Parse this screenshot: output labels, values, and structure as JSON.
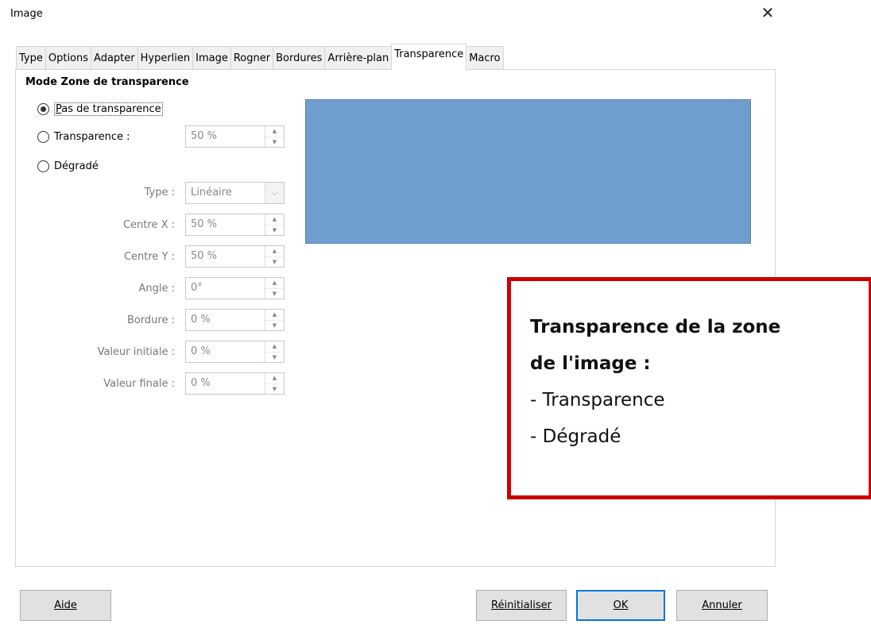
{
  "window": {
    "title": "Image",
    "close_glyph": "✕"
  },
  "tabs": [
    {
      "label": "Type"
    },
    {
      "label": "Options"
    },
    {
      "label": "Adapter"
    },
    {
      "label": "Hyperlien"
    },
    {
      "label": "Image"
    },
    {
      "label": "Rogner"
    },
    {
      "label": "Bordures"
    },
    {
      "label": "Arrière-plan"
    },
    {
      "label": "Transparence",
      "active": true
    },
    {
      "label": "Macro"
    }
  ],
  "section": {
    "title": "Mode Zone de transparence"
  },
  "radios": {
    "none": {
      "label": "Pas de transparence",
      "checked": true
    },
    "transparency": {
      "label": "Transparence :",
      "value": "50 %"
    },
    "gradient": {
      "label": "Dégradé"
    }
  },
  "gradient_fields": {
    "type": {
      "label": "Type :",
      "value": "Linéaire"
    },
    "center_x": {
      "label": "Centre X :",
      "value": "50 %"
    },
    "center_y": {
      "label": "Centre Y :",
      "value": "50 %"
    },
    "angle": {
      "label": "Angle :",
      "value": "0°"
    },
    "border": {
      "label": "Bordure :",
      "value": "0 %"
    },
    "start_value": {
      "label": "Valeur initiale :",
      "value": "0 %"
    },
    "end_value": {
      "label": "Valeur finale :",
      "value": "0 %"
    }
  },
  "preview": {
    "color": "#6f9dcd"
  },
  "callout": {
    "line1": "Transparence de la zone",
    "line2": "de l'image :",
    "line3": "- Transparence",
    "line4": "- Dégradé",
    "border_color": "#cc0000"
  },
  "buttons": {
    "help": "Aide",
    "reset": "Réinitialiser",
    "ok": "OK",
    "cancel": "Annuler"
  },
  "icons": {
    "spin": "spin-updown-icon",
    "dropdown": "chevron-down-icon",
    "close": "close-icon"
  }
}
